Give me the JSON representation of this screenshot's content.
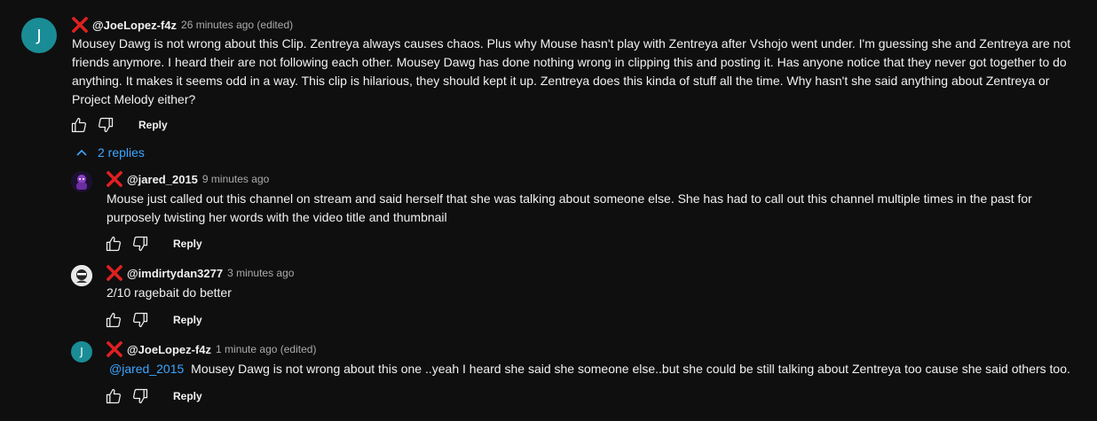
{
  "comment": {
    "avatar_letter": "J",
    "author": "@JoeLopez-f4z",
    "time": "26 minutes ago (edited)",
    "text": "Mousey Dawg is not wrong about this Clip. Zentreya always causes chaos. Plus why Mouse hasn't play with Zentreya after Vshojo went under. I'm guessing she and Zentreya are not friends anymore. I heard their are not following each other. Mousey Dawg has done nothing wrong in clipping this and posting it. Has anyone notice that they never got together to do anything. It makes it seems odd in a way. This clip is hilarious, they should kept it up. Zentreya does this kinda of stuff all the time. Why hasn't she said anything about Zentreya or Project Melody either?",
    "reply_label": "Reply"
  },
  "replies_toggle": {
    "label": "2 replies"
  },
  "replies": [
    {
      "author": "@jared_2015",
      "time": "9 minutes ago",
      "text": "Mouse just called out this channel on stream and said herself that she was talking about someone else. She has had to call out this channel multiple times in the past for purposely twisting her words with the video title and thumbnail",
      "reply_label": "Reply"
    },
    {
      "author": "@imdirtydan3277",
      "time": "3 minutes ago",
      "text": "2/10 ragebait do better",
      "reply_label": "Reply"
    },
    {
      "avatar_letter": "J",
      "author": "@JoeLopez-f4z",
      "time": "1 minute ago (edited)",
      "mention": "@jared_2015",
      "text": "Mousey Dawg is not wrong about this one ..yeah I heard she said she someone else..but she could be still talking about Zentreya too cause she said others too.",
      "reply_label": "Reply"
    }
  ],
  "colors": {
    "background": "#0f0f0f",
    "link": "#3ea6ff",
    "x_mark": "#e02020",
    "avatar_j": "#1a8c96"
  }
}
